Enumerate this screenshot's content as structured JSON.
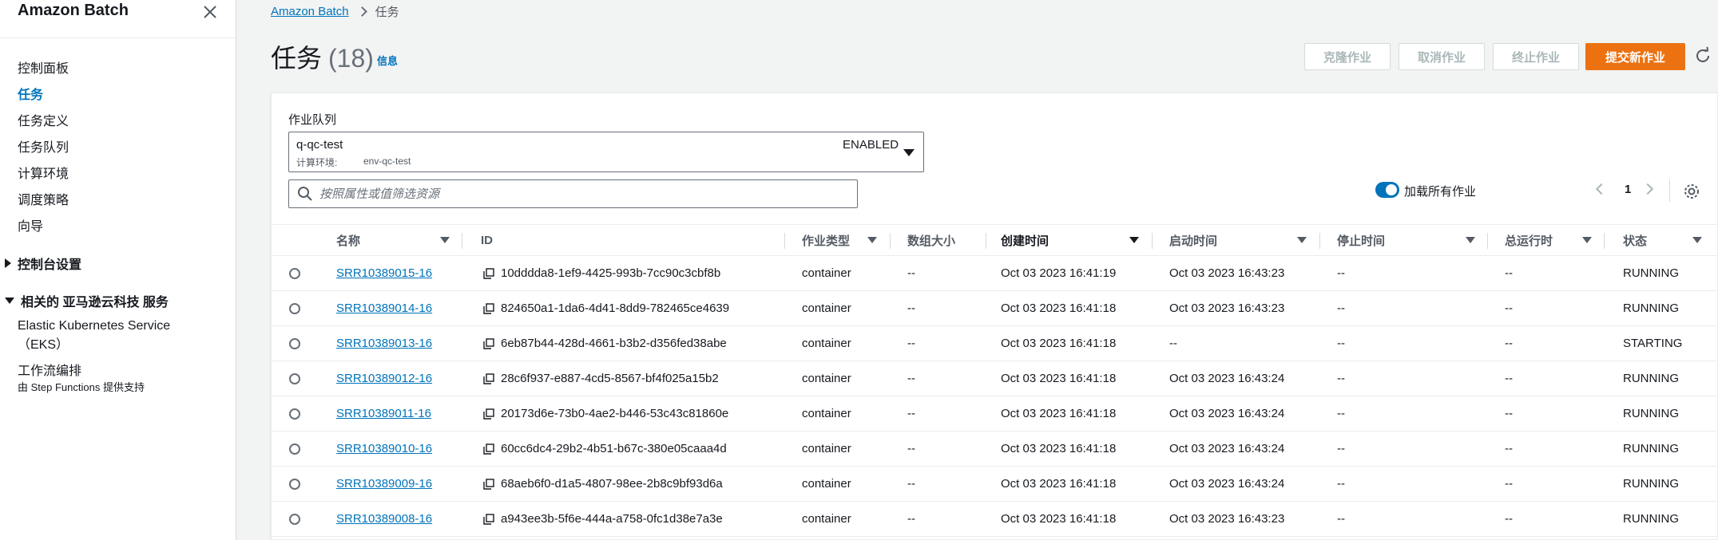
{
  "sidebar": {
    "title": "Amazon Batch",
    "items": [
      "控制面板",
      "任务",
      "任务定义",
      "任务队列",
      "计算环境",
      "调度策略",
      "向导"
    ],
    "console_settings": "控制台设置",
    "related_services": "相关的 亚马逊云科技 服务",
    "eks_line1": "Elastic Kubernetes Service",
    "eks_line2": "（EKS）",
    "workflow_title": "工作流编排",
    "workflow_note": "由 Step Functions 提供支持"
  },
  "breadcrumb": {
    "root": "Amazon Batch",
    "current": "任务"
  },
  "header": {
    "title": "任务",
    "count": "(18)",
    "info": "信息"
  },
  "actions": {
    "clone": "克隆作业",
    "cancel": "取消作业",
    "terminate": "终止作业",
    "submit": "提交新作业"
  },
  "queue": {
    "label": "作业队列",
    "name": "q-qc-test",
    "env_label": "计算环境:",
    "env": "env-qc-test",
    "status": "ENABLED"
  },
  "search": {
    "placeholder": "按照属性或值筛选资源"
  },
  "toggle": {
    "label": "加载所有作业"
  },
  "pagination": {
    "page": "1"
  },
  "table": {
    "headers": {
      "name": "名称",
      "id": "ID",
      "type": "作业类型",
      "array": "数组大小",
      "created": "创建时间",
      "started": "启动时间",
      "stopped": "停止时间",
      "runtime": "总运行时",
      "status": "状态"
    },
    "rows": [
      {
        "name": "SRR10389015-16",
        "id": "10dddda8-1ef9-4425-993b-7cc90c3cbf8b",
        "type": "container",
        "array": "--",
        "created": "Oct 03 2023 16:41:19",
        "started": "Oct 03 2023 16:43:23",
        "stopped": "--",
        "runtime": "--",
        "status": "RUNNING"
      },
      {
        "name": "SRR10389014-16",
        "id": "824650a1-1da6-4d41-8dd9-782465ce4639",
        "type": "container",
        "array": "--",
        "created": "Oct 03 2023 16:41:18",
        "started": "Oct 03 2023 16:43:23",
        "stopped": "--",
        "runtime": "--",
        "status": "RUNNING"
      },
      {
        "name": "SRR10389013-16",
        "id": "6eb87b44-428d-4661-b3b2-d356fed38abe",
        "type": "container",
        "array": "--",
        "created": "Oct 03 2023 16:41:18",
        "started": "--",
        "stopped": "--",
        "runtime": "--",
        "status": "STARTING"
      },
      {
        "name": "SRR10389012-16",
        "id": "28c6f937-e887-4cd5-8567-bf4f025a15b2",
        "type": "container",
        "array": "--",
        "created": "Oct 03 2023 16:41:18",
        "started": "Oct 03 2023 16:43:24",
        "stopped": "--",
        "runtime": "--",
        "status": "RUNNING"
      },
      {
        "name": "SRR10389011-16",
        "id": "20173d6e-73b0-4ae2-b446-53c43c81860e",
        "type": "container",
        "array": "--",
        "created": "Oct 03 2023 16:41:18",
        "started": "Oct 03 2023 16:43:24",
        "stopped": "--",
        "runtime": "--",
        "status": "RUNNING"
      },
      {
        "name": "SRR10389010-16",
        "id": "60cc6dc4-29b2-4b51-b67c-380e05caaa4d",
        "type": "container",
        "array": "--",
        "created": "Oct 03 2023 16:41:18",
        "started": "Oct 03 2023 16:43:24",
        "stopped": "--",
        "runtime": "--",
        "status": "RUNNING"
      },
      {
        "name": "SRR10389009-16",
        "id": "68aeb6f0-d1a5-4807-98ee-2b8c9bf93d6a",
        "type": "container",
        "array": "--",
        "created": "Oct 03 2023 16:41:18",
        "started": "Oct 03 2023 16:43:24",
        "stopped": "--",
        "runtime": "--",
        "status": "RUNNING"
      },
      {
        "name": "SRR10389008-16",
        "id": "a943ee3b-5f6e-444a-a758-0fc1d38e7a3e",
        "type": "container",
        "array": "--",
        "created": "Oct 03 2023 16:41:18",
        "started": "Oct 03 2023 16:43:23",
        "stopped": "--",
        "runtime": "--",
        "status": "RUNNING"
      }
    ]
  }
}
